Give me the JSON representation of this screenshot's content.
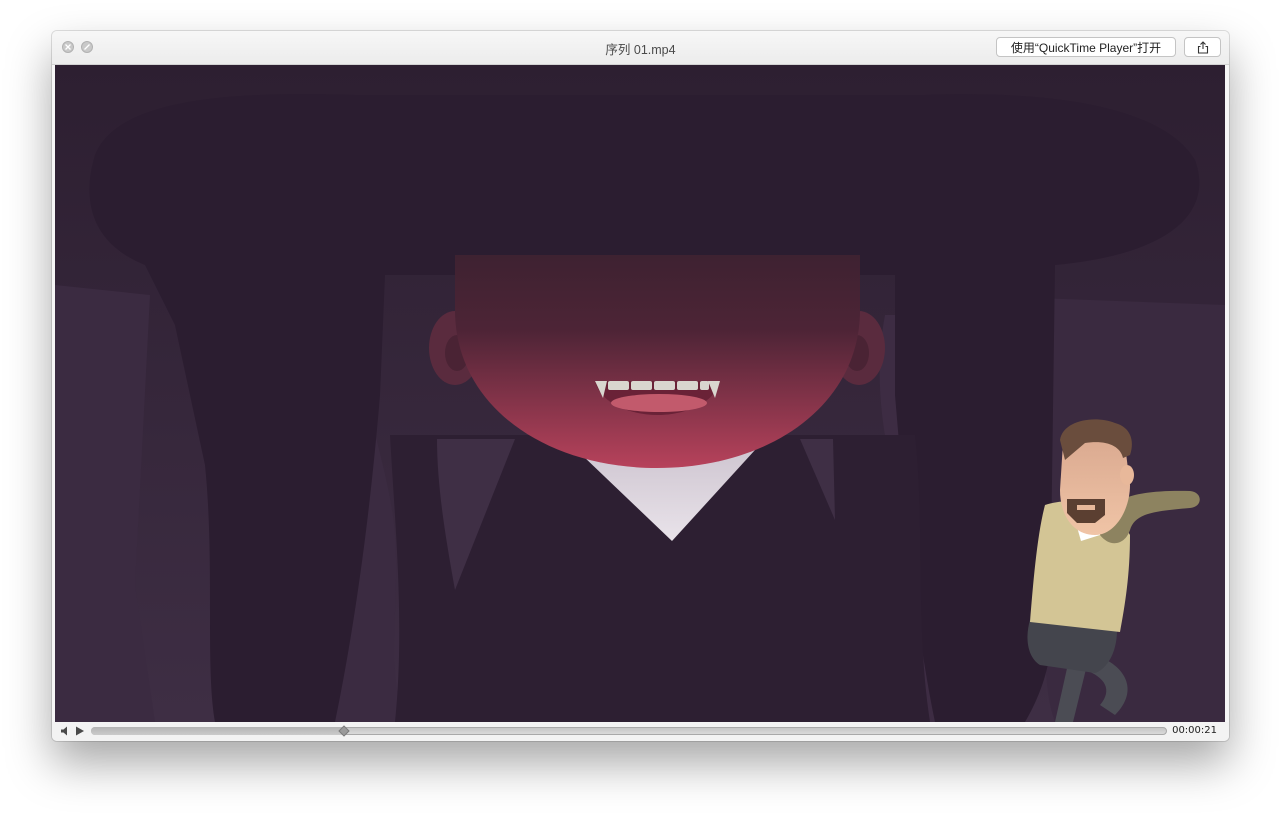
{
  "window": {
    "title": "序列 01.mp4",
    "open_button_label": "使用“QuickTime Player”打开",
    "share_icon": "share-icon"
  },
  "video": {
    "description_icon": "video-frame",
    "colors": {
      "background": "#2e2033",
      "figure_dark": "#2b1d2f",
      "face_top": "#4a2334",
      "face_bottom": "#b5415a",
      "shirt": "#d6cfd8",
      "man_sweater": "#d3c595",
      "man_skin": "#e8b89a",
      "man_hair": "#6a4d3d",
      "man_pants": "#4b4c54"
    }
  },
  "controls": {
    "volume_icon": "speaker-icon",
    "play_icon": "play-icon",
    "progress_percent": 23.5,
    "current_time": "00:00:21"
  }
}
